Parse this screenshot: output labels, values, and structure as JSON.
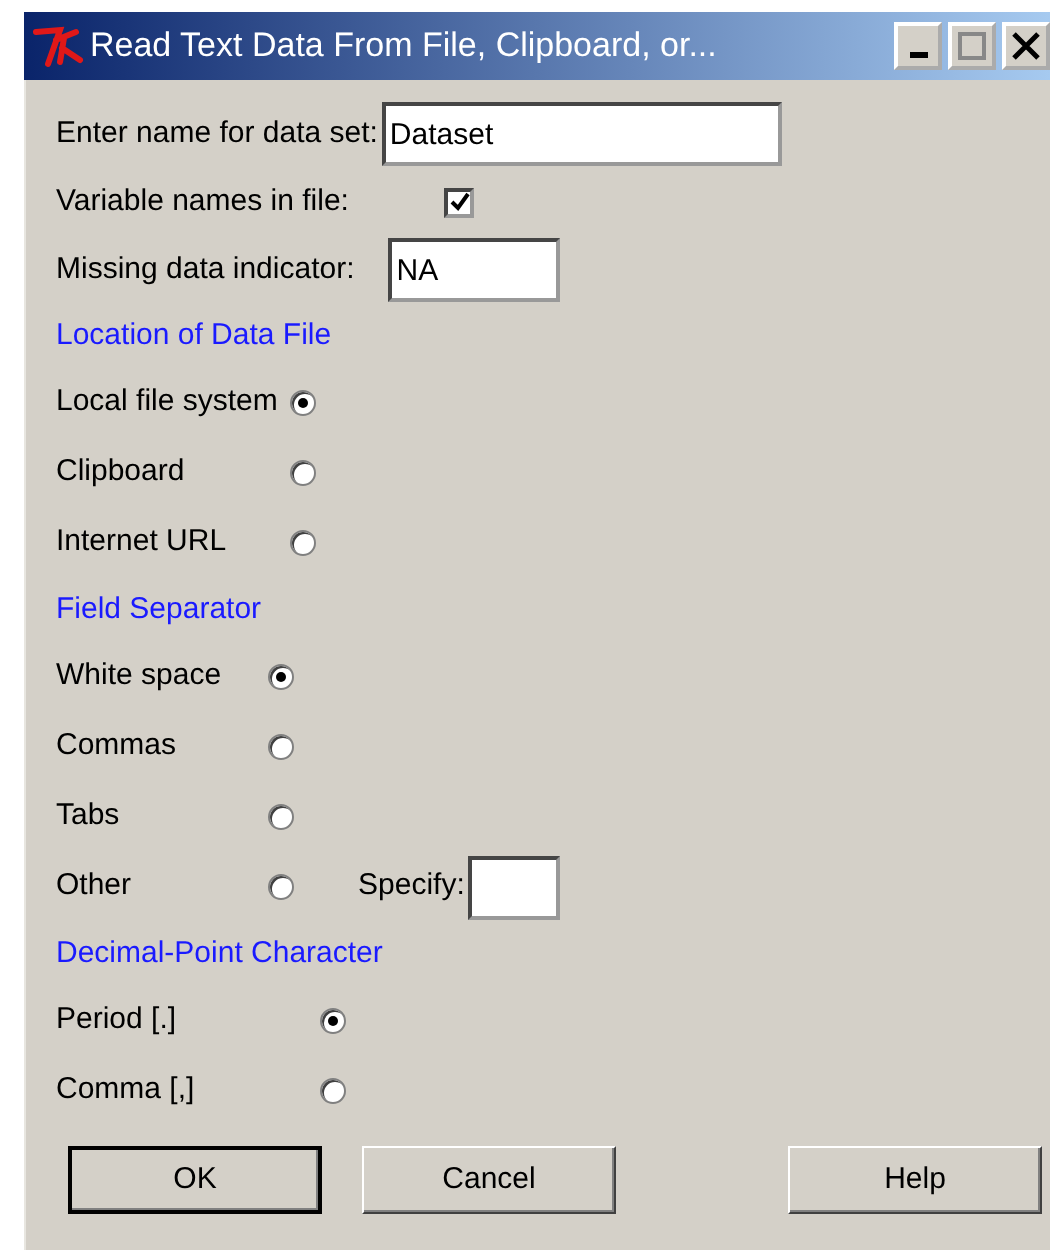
{
  "window": {
    "title": "Read Text Data From File, Clipboard, or..."
  },
  "fields": [
    {
      "kind": "text",
      "label": "Enter name for data set:",
      "value": "Dataset"
    },
    {
      "kind": "checkbox",
      "label": "Variable names in file:",
      "checked": true
    },
    {
      "kind": "short_text",
      "label": "Missing data indicator:",
      "value": "NA"
    }
  ],
  "groups": [
    {
      "title": "Location of Data File",
      "options": [
        {
          "label": "Local file system",
          "selected": true
        },
        {
          "label": "Clipboard",
          "selected": false
        },
        {
          "label": "Internet URL",
          "selected": false
        }
      ]
    },
    {
      "title": "Field Separator",
      "options": [
        {
          "label": "White space",
          "selected": true
        },
        {
          "label": "Commas",
          "selected": false
        },
        {
          "label": "Tabs",
          "selected": false
        },
        {
          "label": "Other",
          "selected": false,
          "specify": {
            "label": "Specify:"
          }
        }
      ]
    },
    {
      "title": "Decimal-Point Character",
      "options": [
        {
          "label": "Period [.]",
          "selected": true
        },
        {
          "label": "Comma [,]",
          "selected": false
        }
      ]
    }
  ],
  "buttons": [
    {
      "label": "OK",
      "default": true
    },
    {
      "label": "Cancel",
      "default": false
    },
    {
      "label": "Help",
      "default": false
    }
  ]
}
